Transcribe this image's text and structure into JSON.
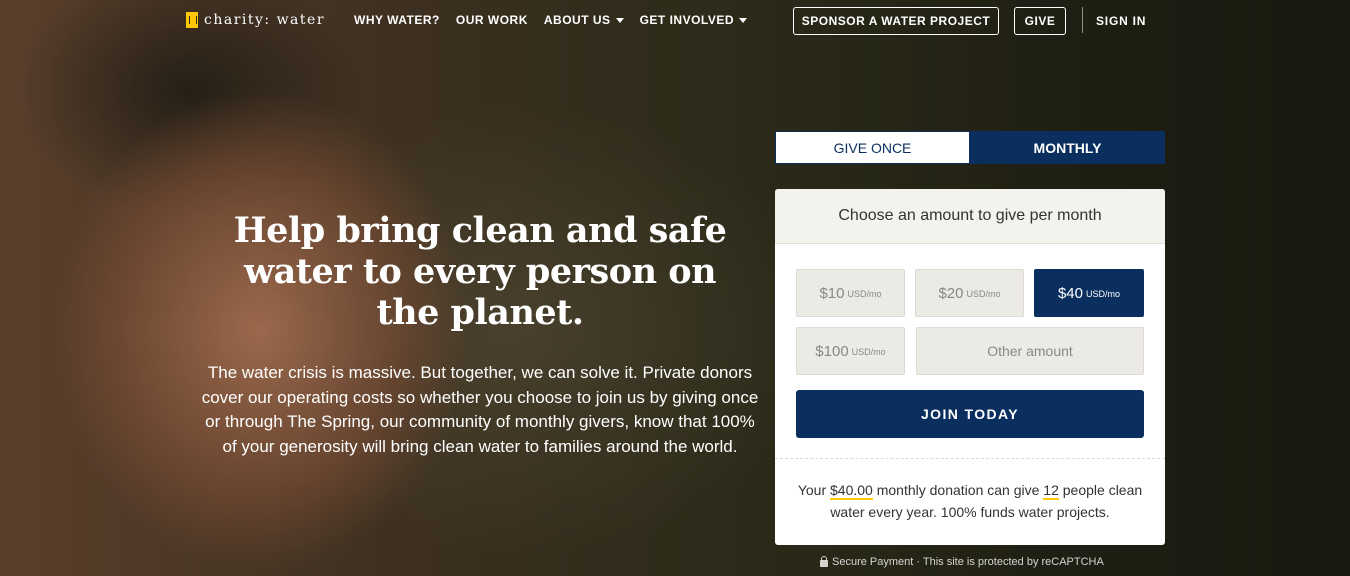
{
  "header": {
    "logo_text": "charity: water",
    "nav": [
      {
        "label": "WHY WATER?"
      },
      {
        "label": "OUR WORK"
      },
      {
        "label": "ABOUT US"
      },
      {
        "label": "GET INVOLVED"
      }
    ],
    "sponsor_label": "SPONSOR A WATER PROJECT",
    "give_label": "GIVE",
    "signin_label": "SIGN IN"
  },
  "hero": {
    "title": "Help bring clean and safe water to every person on the planet.",
    "body": "The water crisis is massive. But together, we can solve it. Private donors cover our operating costs so whether you choose to join us by giving once or through The Spring, our community of monthly givers, know that 100% of your generosity will bring clean water to families around the world."
  },
  "donate": {
    "tabs": [
      {
        "label": "GIVE ONCE"
      },
      {
        "label": "MONTHLY"
      }
    ],
    "card_title": "Choose an amount to give per month",
    "amounts": [
      {
        "value": "$10",
        "unit": "USD/mo"
      },
      {
        "value": "$20",
        "unit": "USD/mo"
      },
      {
        "value": "$40",
        "unit": "USD/mo"
      },
      {
        "value": "$100",
        "unit": "USD/mo"
      }
    ],
    "other_placeholder": "Other amount",
    "join_label": "JOIN TODAY",
    "impact": {
      "prefix": "Your ",
      "amount": "$40.00",
      "middle": " monthly donation can give ",
      "people": "12",
      "suffix": " people clean water every year. 100% funds water projects."
    },
    "secure_text": "Secure Payment · This site is protected by reCAPTCHA"
  },
  "colors": {
    "navy": "#0a2f5f",
    "yellow": "#ffc907"
  }
}
